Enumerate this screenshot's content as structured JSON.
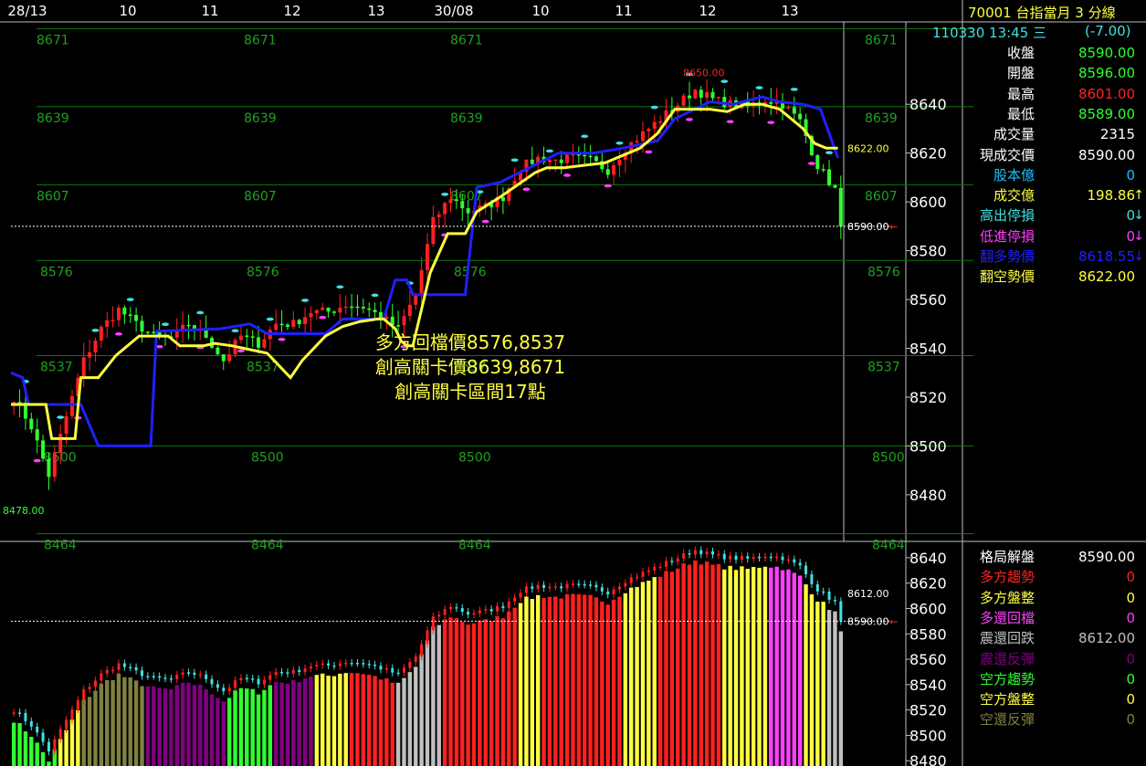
{
  "header": {
    "title": "70001 台指當月 3 分線",
    "datetime": "110330 13:45 三",
    "change": "(-7.00)"
  },
  "colors": {
    "up": "#ff2020",
    "down": "#30ff30",
    "blue_line": "#2020ff",
    "yellow_line": "#ffff40",
    "level_line": "#0a7a0a",
    "level_text": "#1fa01f",
    "cyan": "#40e0e0",
    "magenta": "#ff40ff"
  },
  "info_panel": [
    {
      "label": "收盤",
      "value": "8590.00",
      "label_color": "#ffffff",
      "value_color": "#30ff30"
    },
    {
      "label": "開盤",
      "value": "8596.00",
      "label_color": "#ffffff",
      "value_color": "#30ff30"
    },
    {
      "label": "最高",
      "value": "8601.00",
      "label_color": "#ffffff",
      "value_color": "#ff2020"
    },
    {
      "label": "最低",
      "value": "8589.00",
      "label_color": "#ffffff",
      "value_color": "#30ff30"
    },
    {
      "label": "成交量",
      "value": "2315",
      "label_color": "#ffffff",
      "value_color": "#ffffff"
    },
    {
      "label": "現成交價",
      "value": "8590.00",
      "label_color": "#ffffff",
      "value_color": "#ffffff"
    },
    {
      "label": "股本億",
      "value": "0",
      "label_color": "#20c0ff",
      "value_color": "#20c0ff"
    },
    {
      "label": "成交億",
      "value": "198.86",
      "label_color": "#ffff40",
      "value_color": "#ffff40",
      "arrow": "↑",
      "arrow_color": "#ffff40"
    },
    {
      "label": "高出停損",
      "value": "0",
      "label_color": "#40e0e0",
      "value_color": "#40e0e0",
      "arrow": "↓",
      "arrow_color": "#40e0e0"
    },
    {
      "label": "低進停損",
      "value": "0",
      "label_color": "#ff40ff",
      "value_color": "#ff40ff",
      "arrow": "↓",
      "arrow_color": "#ff40ff"
    },
    {
      "label": "翻多勢價",
      "value": "8618.55",
      "label_color": "#2020ff",
      "value_color": "#2020ff",
      "arrow": "↓",
      "arrow_color": "#2020ff"
    },
    {
      "label": "翻空勢價",
      "value": "8622.00",
      "label_color": "#ffff40",
      "value_color": "#ffff40"
    }
  ],
  "lower_panel": [
    {
      "label": "格局解盤",
      "value": "8590.00",
      "label_color": "#ffffff",
      "value_color": "#ffffff"
    },
    {
      "label": "多方趨勢",
      "value": "0",
      "label_color": "#ff2020",
      "value_color": "#ff2020"
    },
    {
      "label": "多方盤整",
      "value": "0",
      "label_color": "#ffff40",
      "value_color": "#ffff40"
    },
    {
      "label": "多還回檔",
      "value": "0",
      "label_color": "#ff40ff",
      "value_color": "#ff40ff"
    },
    {
      "label": "震還回跌",
      "value": "8612.00",
      "label_color": "#c0c0c0",
      "value_color": "#c0c0c0"
    },
    {
      "label": "震還反彈",
      "value": "0",
      "label_color": "#800080",
      "value_color": "#800080"
    },
    {
      "label": "空方趨勢",
      "value": "0",
      "label_color": "#30ff30",
      "value_color": "#30ff30"
    },
    {
      "label": "空方盤整",
      "value": "0",
      "label_color": "#ffff40",
      "value_color": "#ffff40"
    },
    {
      "label": "空還反彈",
      "value": "0",
      "label_color": "#808040",
      "value_color": "#808040"
    }
  ],
  "chart_data": [
    {
      "type": "candlestick",
      "x_ticks": [
        "28/13",
        "10",
        "11",
        "12",
        "13",
        "30/08",
        "10",
        "11",
        "12",
        "13"
      ],
      "y_ticks": [
        8480,
        8500,
        8520,
        8540,
        8560,
        8580,
        8600,
        8620,
        8640
      ],
      "ylim": [
        8462,
        8673
      ],
      "levels": [
        8671,
        8639,
        8607,
        8576,
        8537,
        8500,
        8464
      ],
      "last_price": "8590.00",
      "last_price_value": 8590,
      "marker_high": "8650.00",
      "marker_low": "8478.00",
      "marker_flip_short": "8622.00",
      "annotations": [
        "多方回檔價8576,8537",
        "創高關卡價8639,8671",
        "創高關卡區間17點"
      ],
      "close_path": [
        [
          0,
          8520
        ],
        [
          3,
          8508
        ],
        [
          6,
          8488
        ],
        [
          9,
          8512
        ],
        [
          12,
          8535
        ],
        [
          15,
          8548
        ],
        [
          18,
          8556
        ],
        [
          21,
          8550
        ],
        [
          24,
          8545
        ],
        [
          27,
          8544
        ],
        [
          30,
          8550
        ],
        [
          33,
          8545
        ],
        [
          36,
          8535
        ],
        [
          39,
          8545
        ],
        [
          42,
          8542
        ],
        [
          45,
          8550
        ],
        [
          48,
          8550
        ],
        [
          51,
          8555
        ],
        [
          54,
          8555
        ],
        [
          57,
          8558
        ],
        [
          60,
          8557
        ],
        [
          63,
          8553
        ],
        [
          66,
          8548
        ],
        [
          69,
          8562
        ],
        [
          72,
          8592
        ],
        [
          75,
          8602
        ],
        [
          78,
          8596
        ],
        [
          81,
          8598
        ],
        [
          84,
          8602
        ],
        [
          87,
          8614
        ],
        [
          90,
          8618
        ],
        [
          93,
          8617
        ],
        [
          96,
          8618
        ],
        [
          99,
          8617
        ],
        [
          102,
          8613
        ],
        [
          105,
          8622
        ],
        [
          108,
          8628
        ],
        [
          111,
          8634
        ],
        [
          114,
          8640
        ],
        [
          117,
          8646
        ],
        [
          120,
          8642
        ],
        [
          123,
          8640
        ],
        [
          126,
          8639
        ],
        [
          129,
          8642
        ],
        [
          132,
          8640
        ],
        [
          135,
          8633
        ],
        [
          138,
          8615
        ],
        [
          141,
          8605
        ],
        [
          142,
          8590
        ]
      ],
      "blue_line": [
        [
          0,
          8530
        ],
        [
          2,
          8528
        ],
        [
          3,
          8517
        ],
        [
          12,
          8517
        ],
        [
          15,
          8500
        ],
        [
          24,
          8500
        ],
        [
          25,
          8547
        ],
        [
          36,
          8548
        ],
        [
          41,
          8550
        ],
        [
          44,
          8546
        ],
        [
          48,
          8546
        ],
        [
          54,
          8546
        ],
        [
          57,
          8552
        ],
        [
          64,
          8552
        ],
        [
          66,
          8568
        ],
        [
          68,
          8568
        ],
        [
          69,
          8562
        ],
        [
          78,
          8562
        ],
        [
          80,
          8606
        ],
        [
          84,
          8608
        ],
        [
          94,
          8620
        ],
        [
          100,
          8620
        ],
        [
          105,
          8622
        ],
        [
          111,
          8625
        ],
        [
          114,
          8634
        ],
        [
          120,
          8641
        ],
        [
          124,
          8640
        ],
        [
          129,
          8643
        ],
        [
          132,
          8641
        ],
        [
          136,
          8640
        ],
        [
          139,
          8638
        ],
        [
          142,
          8618
        ]
      ],
      "yellow_line": [
        [
          0,
          8517
        ],
        [
          6,
          8517
        ],
        [
          7,
          8503
        ],
        [
          11,
          8503
        ],
        [
          12,
          8528
        ],
        [
          15,
          8528
        ],
        [
          18,
          8537
        ],
        [
          22,
          8545
        ],
        [
          27,
          8545
        ],
        [
          29,
          8541
        ],
        [
          33,
          8541
        ],
        [
          35,
          8542
        ],
        [
          38,
          8541
        ],
        [
          44,
          8538
        ],
        [
          48,
          8528
        ],
        [
          50,
          8535
        ],
        [
          54,
          8545
        ],
        [
          57,
          8549
        ],
        [
          60,
          8551
        ],
        [
          63,
          8552
        ],
        [
          64,
          8552
        ],
        [
          66,
          8548
        ],
        [
          67,
          8543
        ],
        [
          68,
          8541
        ],
        [
          69,
          8541
        ],
        [
          72,
          8571
        ],
        [
          75,
          8587
        ],
        [
          78,
          8587
        ],
        [
          80,
          8596
        ],
        [
          84,
          8602
        ],
        [
          90,
          8612
        ],
        [
          92,
          8614
        ],
        [
          95,
          8614
        ],
        [
          102,
          8616
        ],
        [
          108,
          8622
        ],
        [
          111,
          8628
        ],
        [
          114,
          8638
        ],
        [
          120,
          8638
        ],
        [
          123,
          8637
        ],
        [
          126,
          8640
        ],
        [
          129,
          8640
        ],
        [
          132,
          8638
        ],
        [
          136,
          8630
        ],
        [
          138,
          8624
        ],
        [
          140,
          8622
        ],
        [
          142,
          8622
        ]
      ],
      "lower_y_ticks": [
        8480,
        8500,
        8520,
        8540,
        8560,
        8580,
        8600,
        8620,
        8640
      ],
      "lower_ylim": [
        8478,
        8650
      ],
      "lower_marker": "8612.00",
      "lower_last": "8590.00"
    }
  ]
}
